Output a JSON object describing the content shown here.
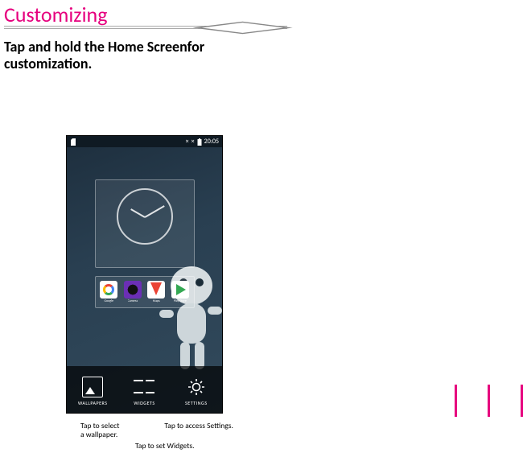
{
  "page": {
    "title": "Customizing",
    "instruction": "Tap and hold the Home Screenfor customization."
  },
  "phone": {
    "statusbar": {
      "time": "20:05"
    },
    "apps": [
      {
        "name": "Google"
      },
      {
        "name": "Camera"
      },
      {
        "name": "Maps"
      },
      {
        "name": "Play Store"
      }
    ],
    "bottom": {
      "wallpapers": "WALLPAPERS",
      "widgets": "WIDGETS",
      "settings": "SETTINGS"
    }
  },
  "captions": {
    "wallpaper_line1": "Tap to select",
    "wallpaper_line2": "a wallpaper.",
    "settings": "Tap to access Settings.",
    "widgets": "Tap to set Widgets."
  }
}
